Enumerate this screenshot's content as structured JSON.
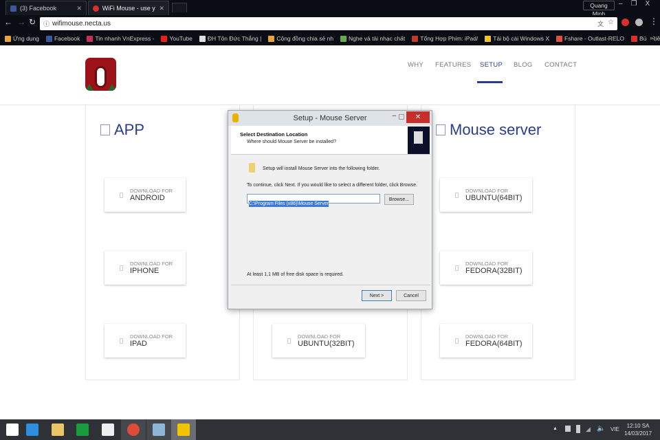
{
  "browser": {
    "tabs": [
      {
        "label": "(3) Facebook",
        "icon": "facebook-icon"
      },
      {
        "label": "WiFi Mouse - use your p",
        "icon": "apple-icon"
      }
    ],
    "profile": "Quang Minh",
    "url": "wifimouse.necta.us",
    "bookmarks": [
      {
        "label": "Ứng dụng",
        "color": "#e8a33c"
      },
      {
        "label": "Facebook",
        "color": "#3b5998"
      },
      {
        "label": "Tin nhanh VnExpress -",
        "color": "#c4305a"
      },
      {
        "label": "YouTube",
        "color": "#e62117"
      },
      {
        "label": "ĐH Tôn Đức Thắng |",
        "color": "#dddddd"
      },
      {
        "label": "Cộng đồng chia sẻ nh",
        "color": "#e8a33c"
      },
      {
        "label": "Nghe và tải nhạc chất",
        "color": "#6aa84f"
      },
      {
        "label": "Tổng Hợp Phim: iPad/",
        "color": "#c0392b"
      },
      {
        "label": "Tải bộ cài Windows X",
        "color": "#f1c232"
      },
      {
        "label": "Fshare - Outlast-RELO",
        "color": "#e05040"
      },
      {
        "label": "Bún Riêu - Hẻm Nguy",
        "color": "#d9302f"
      }
    ],
    "more": "»"
  },
  "site": {
    "nav": [
      "WHY",
      "FEATURES",
      "SETUP",
      "BLOG",
      "CONTACT"
    ],
    "active_nav": "SETUP",
    "accent": "#2b3b8f",
    "app_heading": "APP",
    "server_heading": "Mouse server",
    "download_prefix": "DOWNLOAD FOR",
    "app_cards": [
      "ANDROID",
      "IPHONE",
      "IPAD"
    ],
    "middle_cards": [
      "UBUNTU(32BIT)"
    ],
    "server_cards": [
      "UBUNTU(64BIT)",
      "FEDORA(32BIT)",
      "FEDORA(64BIT)"
    ]
  },
  "dialog": {
    "title": "Setup - Mouse Server",
    "heading": "Select Destination Location",
    "subheading": "Where should Mouse Server be installed?",
    "info": "Setup will install Mouse Server into the following folder.",
    "instructions": "To continue, click Next. If you would like to select a different folder, click Browse.",
    "path": "C:\\Program Files (x86)\\Mouse Server",
    "browse": "Browse...",
    "space": "At least 1,1 MB of free disk space is required.",
    "next": "Next >",
    "cancel": "Cancel"
  },
  "taskbar": {
    "apps": [
      "start",
      "internet-explorer",
      "file-explorer",
      "store",
      "app",
      "chrome",
      "paint",
      "wifi-mouse"
    ],
    "lang": "VIE",
    "time": "12:10 SA",
    "date": "14/03/2017"
  }
}
